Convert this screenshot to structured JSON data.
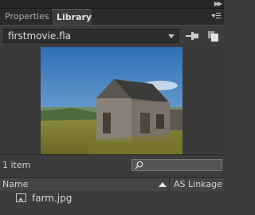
{
  "tabs": [
    {
      "label": "Properties"
    },
    {
      "label": "Library"
    }
  ],
  "file_selector": {
    "value": "firstmovie.fla"
  },
  "preview": {
    "image": "farm scene with gray wooden barn under blue sky"
  },
  "count": "1 item",
  "columns": {
    "name": "Name",
    "linkage": "AS Linkage"
  },
  "items": [
    {
      "name": "farm.jpg",
      "icon": "bitmap-icon"
    }
  ],
  "colors": {
    "panel_bg": "#3c3c3c",
    "tab_bar": "#2b2b2b"
  }
}
